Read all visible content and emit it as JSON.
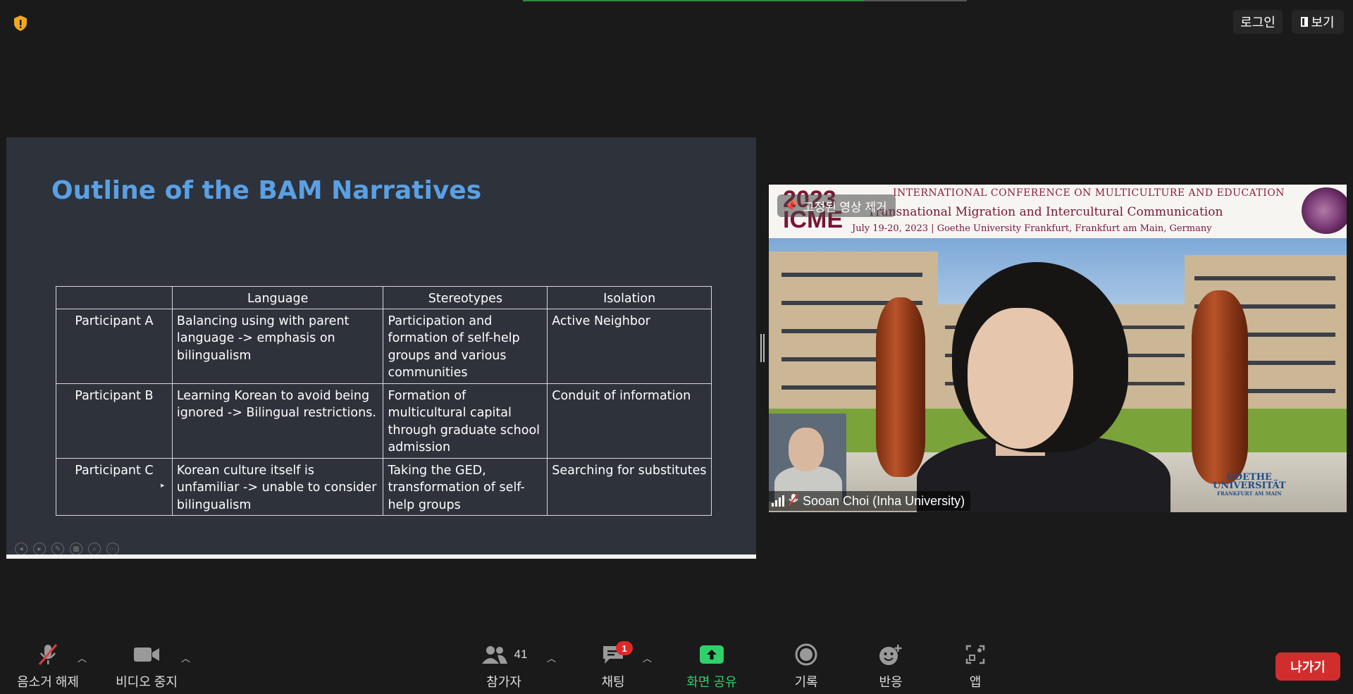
{
  "top_bar": {
    "login_label": "로그인",
    "view_label": "보기"
  },
  "slide": {
    "title": "Outline of the BAM Narratives",
    "table": {
      "headers": [
        "",
        "Language",
        "Stereotypes",
        "Isolation"
      ],
      "rows": [
        {
          "participant": "Participant A",
          "language": "Balancing using with parent language -> emphasis on bilingualism",
          "stereotypes": "Participation and formation of self-help groups and various communities",
          "isolation": "Active Neighbor"
        },
        {
          "participant": "Participant B",
          "language": "Learning Korean to avoid being ignored -> Bilingual restrictions.",
          "stereotypes": "Formation of multicultural capital through graduate school admission",
          "isolation": "Conduit of information"
        },
        {
          "participant": "Participant C",
          "language": "Korean culture itself is unfamiliar -> unable to consider bilingualism",
          "stereotypes": "Taking the GED, transformation of self-help groups",
          "isolation": "Searching for substitutes"
        }
      ]
    }
  },
  "video": {
    "banner": {
      "year": "2023",
      "acronym": "ICME",
      "line1": "INTERNATIONAL CONFERENCE ON MULTICULTURE AND EDUCATION",
      "line2": "Transnational Migration and Intercultural Communication",
      "line3": "July 19-20, 2023 | Goethe University Frankfurt, Frankfurt am Main, Germany"
    },
    "pinned_label": "고정된 영상 제거",
    "participant_name": "Sooan Choi (Inha University)",
    "logo_line1": "GOETHE",
    "logo_line2": "UNIVERSITÄT",
    "logo_line3": "FRANKFURT AM MAIN"
  },
  "toolbar": {
    "unmute_label": "음소거 해제",
    "stop_video_label": "비디오 중지",
    "participants_label": "참가자",
    "participants_count": "41",
    "chat_label": "채팅",
    "chat_badge": "1",
    "share_label": "화면 공유",
    "record_label": "기록",
    "reactions_label": "반응",
    "apps_label": "앱",
    "leave_label": "나가기"
  },
  "colors": {
    "share_green": "#2fd06a",
    "leave_red": "#d22d2d",
    "slide_title_blue": "#5aa0e4"
  }
}
